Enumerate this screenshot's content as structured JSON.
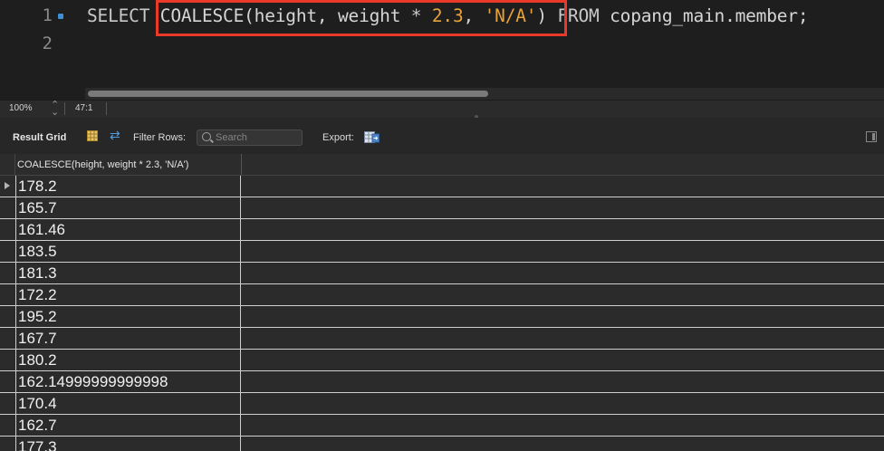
{
  "editor": {
    "line_numbers": [
      "1",
      "2"
    ],
    "sql": {
      "select_kw": "SELECT",
      "fn_name": "COALESCE",
      "open_paren": "(",
      "arg1": "height",
      "comma1": ", ",
      "arg2": "weight",
      "op": " * ",
      "num": "2.3",
      "comma2": ", ",
      "str": "'N/A'",
      "close_paren": ")",
      "from_kw": "FROM",
      "table": "copang_main.member;"
    }
  },
  "status": {
    "zoom": "100%",
    "cursor": "47:1"
  },
  "toolbar": {
    "result_grid_label": "Result Grid",
    "filter_label": "Filter Rows:",
    "search_placeholder": "Search",
    "export_label": "Export:"
  },
  "grid": {
    "columns": [
      "COALESCE(height, weight * 2.3, 'N/A')"
    ],
    "rows": [
      "178.2",
      "165.7",
      "161.46",
      "183.5",
      "181.3",
      "172.2",
      "195.2",
      "167.7",
      "180.2",
      "162.14999999999998",
      "170.4",
      "162.7",
      "177.3"
    ]
  },
  "colors": {
    "highlight": "#e8392b",
    "accent": "#3d8fd6",
    "literal": "#e8a23a"
  }
}
